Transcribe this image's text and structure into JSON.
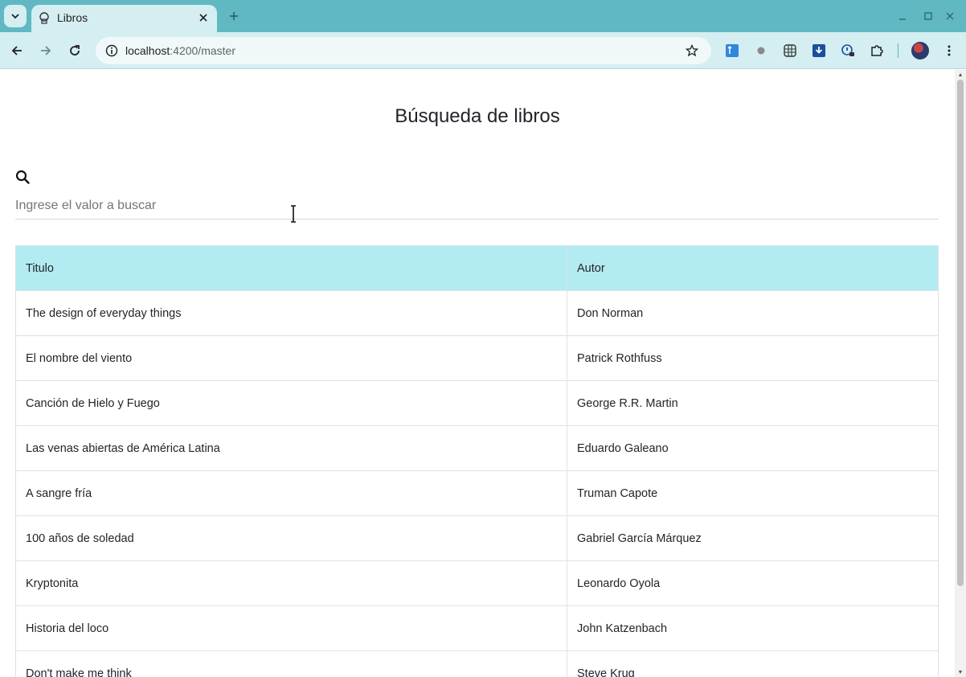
{
  "browser": {
    "tab_title": "Libros",
    "url_host": "localhost",
    "url_path": ":4200/master"
  },
  "page": {
    "title": "Búsqueda de libros",
    "search_placeholder": "Ingrese el valor a buscar",
    "search_value": ""
  },
  "table": {
    "headers": [
      "Titulo",
      "Autor"
    ],
    "rows": [
      [
        "The design of everyday things",
        "Don Norman"
      ],
      [
        "El nombre del viento",
        "Patrick Rothfuss"
      ],
      [
        "Canción de Hielo y Fuego",
        "George R.R. Martin"
      ],
      [
        "Las venas abiertas de América Latina",
        "Eduardo Galeano"
      ],
      [
        "A sangre fría",
        "Truman Capote"
      ],
      [
        "100 años de soledad",
        "Gabriel García Márquez"
      ],
      [
        "Kryptonita",
        "Leonardo Oyola"
      ],
      [
        "Historia del loco",
        "John Katzenbach"
      ],
      [
        "Don't make me think",
        "Steve Krug"
      ]
    ]
  },
  "colors": {
    "tabbar": "#5fb8c2",
    "toolbar": "#d4eef1",
    "table_header": "#b3ebf2"
  }
}
